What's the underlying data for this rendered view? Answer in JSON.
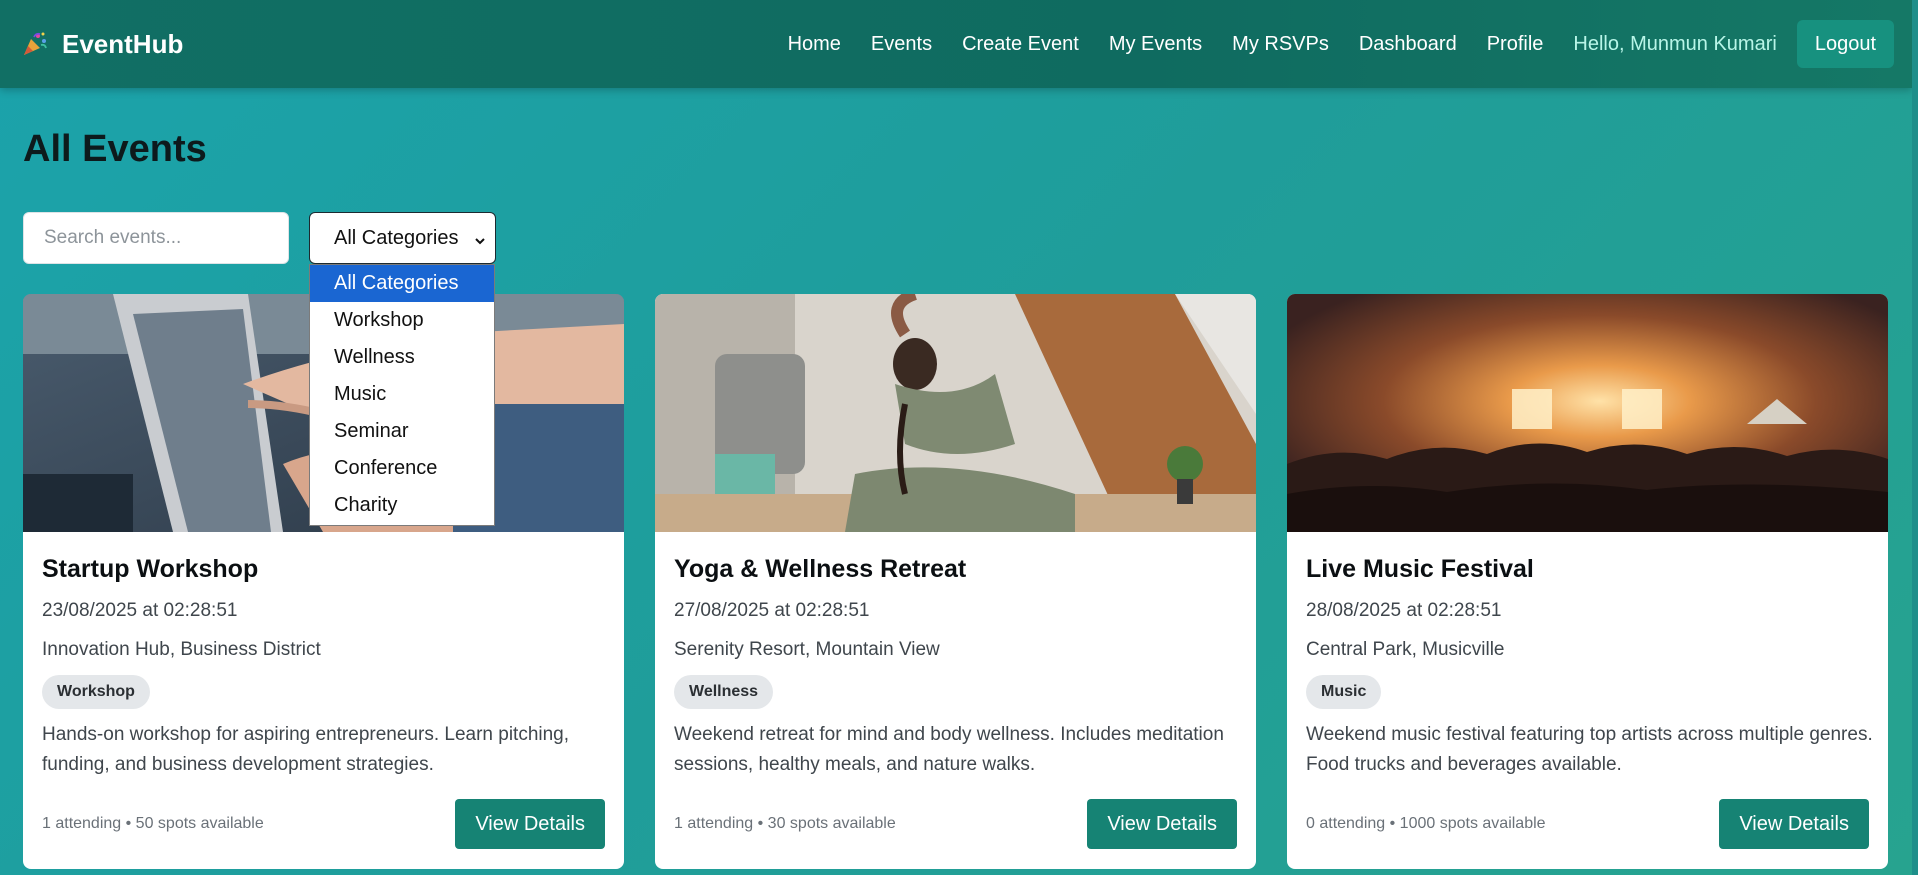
{
  "app": {
    "name": "EventHub",
    "logo_icon": "party-popper-icon"
  },
  "nav": {
    "links": [
      "Home",
      "Events",
      "Create Event",
      "My Events",
      "My RSVPs",
      "Dashboard",
      "Profile"
    ],
    "greeting": "Hello, Munmun Kumari",
    "logout_label": "Logout"
  },
  "page": {
    "title": "All Events"
  },
  "filters": {
    "search_placeholder": "Search events...",
    "category_selected": "All Categories",
    "category_options": [
      "All Categories",
      "Workshop",
      "Wellness",
      "Music",
      "Seminar",
      "Conference",
      "Charity"
    ]
  },
  "events": [
    {
      "title": "Startup Workshop",
      "date": "23/08/2025 at 02:28:51",
      "location": "Innovation Hub, Business District",
      "category": "Workshop",
      "description": "Hands-on workshop for aspiring entrepreneurs. Learn pitching, funding, and business development strategies.",
      "stats": "1 attending • 50 spots available",
      "button_label": "View Details"
    },
    {
      "title": "Yoga & Wellness Retreat",
      "date": "27/08/2025 at 02:28:51",
      "location": "Serenity Resort, Mountain View",
      "category": "Wellness",
      "description": "Weekend retreat for mind and body wellness. Includes meditation sessions, healthy meals, and nature walks.",
      "stats": "1 attending • 30 spots available",
      "button_label": "View Details"
    },
    {
      "title": "Live Music Festival",
      "date": "28/08/2025 at 02:28:51",
      "location": "Central Park, Musicville",
      "category": "Music",
      "description": "Weekend music festival featuring top artists across multiple genres. Food trucks and beverages available.",
      "stats": "0 attending • 1000 spots available",
      "button_label": "View Details"
    }
  ],
  "colors": {
    "navbar": "#116f64",
    "accent_button": "#168374",
    "selected_option": "#1a66d2",
    "greeting": "#b8f5e8"
  }
}
